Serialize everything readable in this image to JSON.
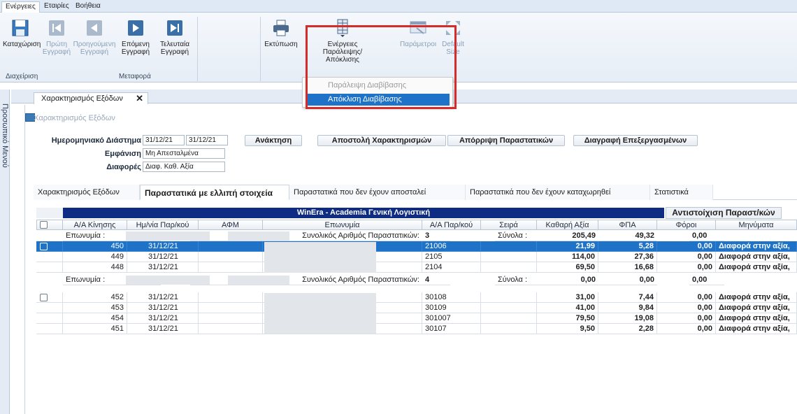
{
  "menu": [
    "Ενέργειες",
    "Εταιρίες",
    "Βοήθεια"
  ],
  "ribbon": {
    "save": "Καταχώριση",
    "first": [
      "Πρώτη",
      "Εγγραφή"
    ],
    "prev": [
      "Προηγούμενη",
      "Εγγραφή"
    ],
    "next": [
      "Επόμενη",
      "Εγγραφή"
    ],
    "last": [
      "Τελευταία",
      "Εγγραφή"
    ],
    "print": "Εκτύπωση",
    "actions": [
      "Ενέργειες",
      "Παράλειψης/Απόκλισης"
    ],
    "params": "Παράμετροι",
    "default_size": [
      "Default",
      "Size"
    ],
    "group_manage": "Διαχείριση",
    "group_transfer": "Μεταφορά"
  },
  "dropdown": {
    "skip": "Παράλειψη Διαβίβασης",
    "deviation": "Απόκλιση Διαβίβασης"
  },
  "left_dock": "Προσωπικό Μενού",
  "doc_tab": "Χαρακτηρισμός Εξόδων",
  "form_title": "Χαρακτηρισμός Εξόδων",
  "filters": {
    "range_label": "Ημερομηνιακό Διάστημα",
    "date_from": "31/12/21",
    "date_to": "31/12/21",
    "show_label": "Εμφάνιση",
    "show_value": "Μη Απεσταλμένα",
    "diff_label": "Διαφορές",
    "diff_value": "Διαφ. Καθ. Αξία"
  },
  "buttons": {
    "retrieve": "Ανάκτηση",
    "send": "Αποστολή Χαρακτηρισμών",
    "reject": "Απόρριψη Παραστατικών",
    "delete": "Διαγραφή Επεξεργασμένων"
  },
  "subtabs": [
    "Χαρακτηρισμός Εξόδων",
    "Παραστατικά με ελλιπή στοιχεία",
    "Παραστατικά που δεν έχουν αποσταλεί",
    "Παραστατικά που δεν έχουν καταχωρηθεί",
    "Στατιστικά"
  ],
  "grid": {
    "title": "WinEra - Academia Γενική Λογιστική",
    "title_right": "Αντιστοίχιση Παραστ/κών",
    "columns": [
      "Α/Α Κίνησης",
      "Ημ/νία Παρ/κού",
      "ΑΦΜ",
      "Επωνυμία",
      "Α/Α Παρ/κού",
      "Σειρά",
      "Καθαρή Αξία",
      "ΦΠΑ",
      "Φόροι",
      "Μηνύματα"
    ],
    "group_company_label": "Επωνυμία :",
    "group_count_label": "Συνολικός Αριθμός Παραστατικών:",
    "group_totals_label": "Σύνολα :",
    "groups": [
      {
        "count": "3",
        "net": "205,49",
        "vat": "49,32",
        "tax": "0,00",
        "rows": [
          {
            "id": "450",
            "date": "31/12/21",
            "doc": "21006",
            "net": "21,99",
            "vat": "5,28",
            "tax": "0,00",
            "msg": "Διαφορά στην αξία,"
          },
          {
            "id": "449",
            "date": "31/12/21",
            "doc": "2105",
            "net": "114,00",
            "vat": "27,36",
            "tax": "0,00",
            "msg": "Διαφορά στην αξία,"
          },
          {
            "id": "448",
            "date": "31/12/21",
            "doc": "2104",
            "net": "69,50",
            "vat": "16,68",
            "tax": "0,00",
            "msg": "Διαφορά στην αξία,"
          }
        ]
      },
      {
        "count": "4",
        "net": "0,00",
        "vat": "0,00",
        "tax": "0,00",
        "rows": [
          {
            "id": "452",
            "date": "31/12/21",
            "doc": "30108",
            "net": "31,00",
            "vat": "7,44",
            "tax": "0,00",
            "msg": "Διαφορά στην αξία,"
          },
          {
            "id": "453",
            "date": "31/12/21",
            "doc": "30109",
            "net": "41,00",
            "vat": "9,84",
            "tax": "0,00",
            "msg": "Διαφορά στην αξία,"
          },
          {
            "id": "454",
            "date": "31/12/21",
            "doc": "301007",
            "net": "79,50",
            "vat": "19,08",
            "tax": "0,00",
            "msg": "Διαφορά στην αξία,"
          },
          {
            "id": "451",
            "date": "31/12/21",
            "doc": "30107",
            "net": "9,50",
            "vat": "2,28",
            "tax": "0,00",
            "msg": "Διαφορά στην αξία,"
          }
        ]
      }
    ]
  }
}
